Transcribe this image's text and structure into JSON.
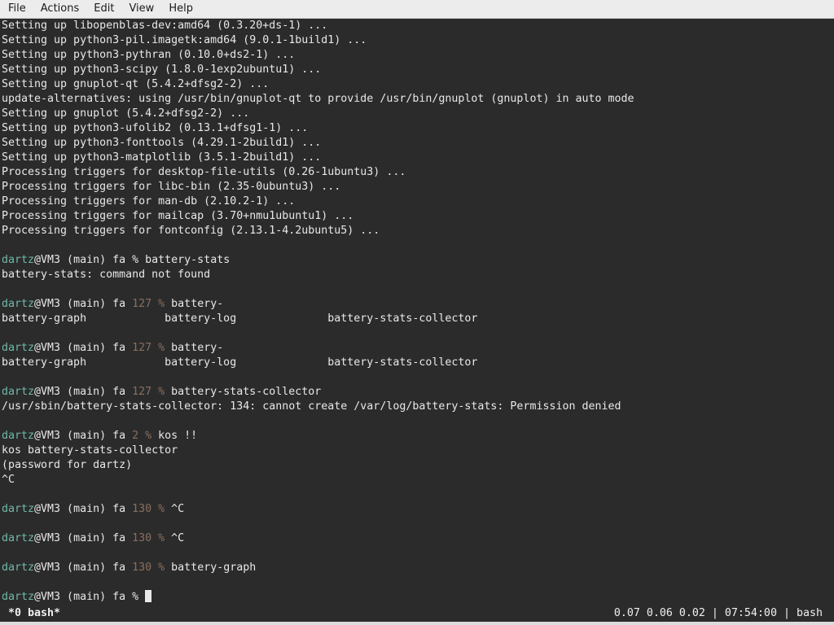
{
  "menubar": {
    "items": [
      "File",
      "Actions",
      "Edit",
      "View",
      "Help"
    ]
  },
  "terminal": {
    "lines": [
      {
        "type": "text",
        "text": "Setting up libopenblas-dev:amd64 (0.3.20+ds-1) ..."
      },
      {
        "type": "text",
        "text": "Setting up python3-pil.imagetk:amd64 (9.0.1-1build1) ..."
      },
      {
        "type": "text",
        "text": "Setting up python3-pythran (0.10.0+ds2-1) ..."
      },
      {
        "type": "text",
        "text": "Setting up python3-scipy (1.8.0-1exp2ubuntu1) ..."
      },
      {
        "type": "text",
        "text": "Setting up gnuplot-qt (5.4.2+dfsg2-2) ..."
      },
      {
        "type": "text",
        "text": "update-alternatives: using /usr/bin/gnuplot-qt to provide /usr/bin/gnuplot (gnuplot) in auto mode"
      },
      {
        "type": "text",
        "text": "Setting up gnuplot (5.4.2+dfsg2-2) ..."
      },
      {
        "type": "text",
        "text": "Setting up python3-ufolib2 (0.13.1+dfsg1-1) ..."
      },
      {
        "type": "text",
        "text": "Setting up python3-fonttools (4.29.1-2build1) ..."
      },
      {
        "type": "text",
        "text": "Setting up python3-matplotlib (3.5.1-2build1) ..."
      },
      {
        "type": "text",
        "text": "Processing triggers for desktop-file-utils (0.26-1ubuntu3) ..."
      },
      {
        "type": "text",
        "text": "Processing triggers for libc-bin (2.35-0ubuntu3) ..."
      },
      {
        "type": "text",
        "text": "Processing triggers for man-db (2.10.2-1) ..."
      },
      {
        "type": "text",
        "text": "Processing triggers for mailcap (3.70+nmu1ubuntu1) ..."
      },
      {
        "type": "text",
        "text": "Processing triggers for fontconfig (2.13.1-4.2ubuntu5) ..."
      },
      {
        "type": "text",
        "text": ""
      },
      {
        "type": "prompt",
        "user": "dartz",
        "host": "@VM3 (main) fa ",
        "code": "",
        "sym": "% ",
        "cmd": "battery-stats"
      },
      {
        "type": "text",
        "text": "battery-stats: command not found"
      },
      {
        "type": "text",
        "text": ""
      },
      {
        "type": "prompt",
        "user": "dartz",
        "host": "@VM3 (main) fa ",
        "code": "127 ",
        "sym": "% ",
        "cmd": "battery-"
      },
      {
        "type": "text",
        "text": "battery-graph            battery-log              battery-stats-collector"
      },
      {
        "type": "text",
        "text": ""
      },
      {
        "type": "prompt",
        "user": "dartz",
        "host": "@VM3 (main) fa ",
        "code": "127 ",
        "sym": "% ",
        "cmd": "battery-"
      },
      {
        "type": "text",
        "text": "battery-graph            battery-log              battery-stats-collector"
      },
      {
        "type": "text",
        "text": ""
      },
      {
        "type": "prompt",
        "user": "dartz",
        "host": "@VM3 (main) fa ",
        "code": "127 ",
        "sym": "% ",
        "cmd": "battery-stats-collector"
      },
      {
        "type": "text",
        "text": "/usr/sbin/battery-stats-collector: 134: cannot create /var/log/battery-stats: Permission denied"
      },
      {
        "type": "text",
        "text": ""
      },
      {
        "type": "prompt",
        "user": "dartz",
        "host": "@VM3 (main) fa ",
        "code": "2 ",
        "sym": "% ",
        "cmd": "kos !!"
      },
      {
        "type": "text",
        "text": "kos battery-stats-collector"
      },
      {
        "type": "text",
        "text": "(password for dartz)"
      },
      {
        "type": "text",
        "text": "^C"
      },
      {
        "type": "text",
        "text": ""
      },
      {
        "type": "prompt",
        "user": "dartz",
        "host": "@VM3 (main) fa ",
        "code": "130 ",
        "sym": "% ",
        "cmd": "^C"
      },
      {
        "type": "text",
        "text": ""
      },
      {
        "type": "prompt",
        "user": "dartz",
        "host": "@VM3 (main) fa ",
        "code": "130 ",
        "sym": "% ",
        "cmd": "^C"
      },
      {
        "type": "text",
        "text": ""
      },
      {
        "type": "prompt",
        "user": "dartz",
        "host": "@VM3 (main) fa ",
        "code": "130 ",
        "sym": "% ",
        "cmd": "battery-graph"
      },
      {
        "type": "text",
        "text": ""
      },
      {
        "type": "prompt",
        "user": "dartz",
        "host": "@VM3 (main) fa ",
        "code": "",
        "sym": "% ",
        "cmd": "",
        "cursor": true
      }
    ]
  },
  "statusbar": {
    "window": "*0 bash*",
    "right": "0.07 0.06 0.02 | 07:54:00 | bash"
  },
  "colors": {
    "background": "#2b2b2b",
    "foreground": "#e8e8e8",
    "user": "#6fb8a8",
    "exit_code": "#8a6f5f"
  }
}
